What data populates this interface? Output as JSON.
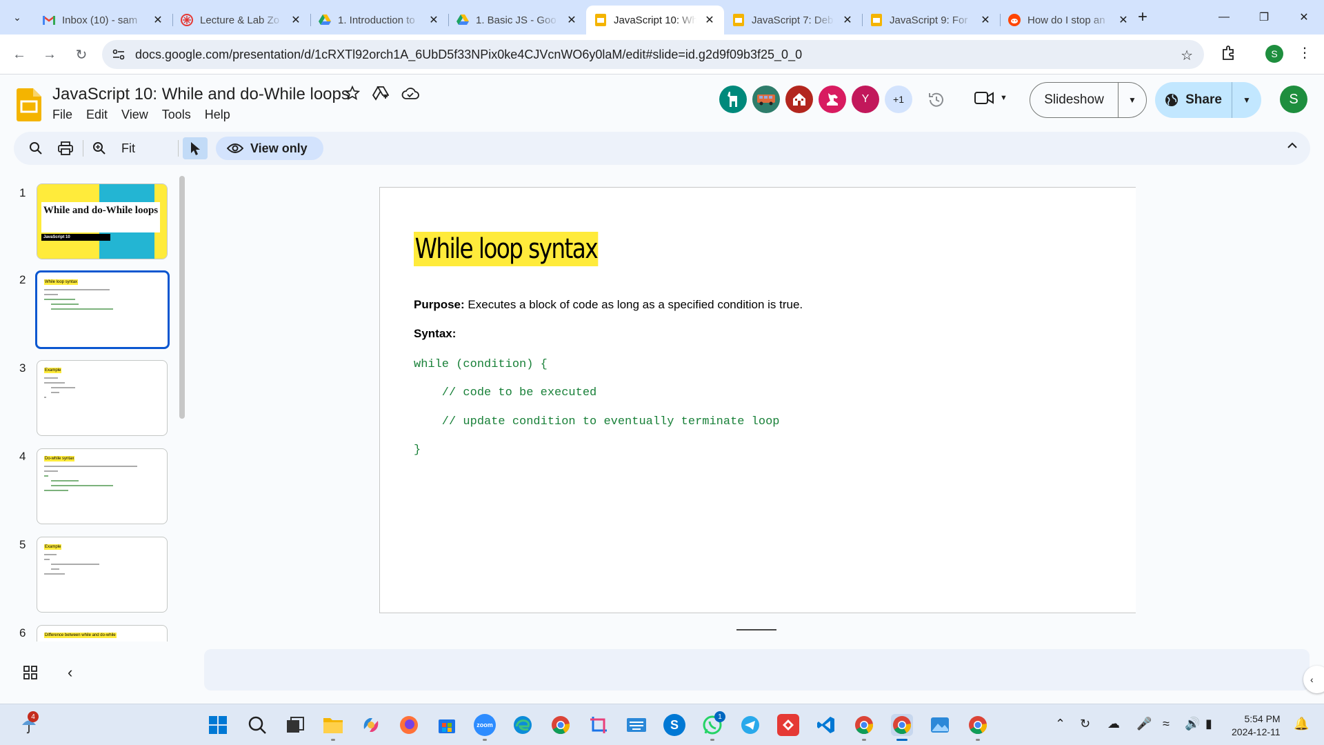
{
  "browser": {
    "tabs": [
      {
        "title": "Inbox (10) - sam",
        "icon": "gmail-icon",
        "active": false
      },
      {
        "title": "Lecture & Lab Zo",
        "icon": "asterisk-icon",
        "active": false
      },
      {
        "title": "1. Introduction to",
        "icon": "google-drive-icon",
        "active": false
      },
      {
        "title": "1. Basic JS - Goo",
        "icon": "google-drive-icon",
        "active": false
      },
      {
        "title": "JavaScript 10: Wh",
        "icon": "google-slides-icon",
        "active": true
      },
      {
        "title": "JavaScript 7: Deb",
        "icon": "google-slides-icon",
        "active": false
      },
      {
        "title": "JavaScript 9: For",
        "icon": "google-slides-icon",
        "active": false
      },
      {
        "title": "How do I stop an",
        "icon": "reddit-icon",
        "active": false
      }
    ],
    "url": "docs.google.com/presentation/d/1cRXTl92orch1A_6UbD5f33NPix0ke4CJVcnWO6y0laM/edit#slide=id.g2d9f09b3f25_0_0",
    "profile_initial": "S"
  },
  "slides_app": {
    "doc_title": "JavaScript 10: While and do-While loops",
    "menu": [
      "File",
      "Edit",
      "View",
      "Tools",
      "Help"
    ],
    "collaborators": [
      {
        "label": "",
        "color": "#00897b",
        "icon": "llama-icon"
      },
      {
        "label": "",
        "color": "#2e7d6b",
        "icon": "bus-icon"
      },
      {
        "label": "",
        "color": "#b3261e",
        "icon": "house-icon"
      },
      {
        "label": "",
        "color": "#d81b60",
        "icon": "horse-icon"
      },
      {
        "label": "Y",
        "color": "#c2185b",
        "icon": ""
      }
    ],
    "more_collaborators": "+1",
    "slideshow_label": "Slideshow",
    "share_label": "Share",
    "account_initial": "S",
    "toolbar": {
      "zoom": "Fit",
      "view_only": "View only"
    }
  },
  "filmstrip": [
    {
      "num": "1",
      "title": "While and do-While loops",
      "tag": "JavaScript 10"
    },
    {
      "num": "2",
      "title": "While loop syntax"
    },
    {
      "num": "3",
      "title": "Example"
    },
    {
      "num": "4",
      "title": "Do-while syntax"
    },
    {
      "num": "5",
      "title": "Example"
    },
    {
      "num": "6",
      "title": "Difference between while and do-while"
    }
  ],
  "slide": {
    "title": "While loop syntax",
    "purpose_label": "Purpose:",
    "purpose_text": " Executes a block of code as long as a specified condition is true.",
    "syntax_label": "Syntax:",
    "code": [
      "while (condition) {",
      "    // code to be executed",
      "    // update condition to eventually terminate loop",
      "}"
    ]
  },
  "taskbar": {
    "notification_count": "4",
    "whatsapp_badge": "1",
    "time": "5:54 PM",
    "date": "2024-12-11"
  }
}
